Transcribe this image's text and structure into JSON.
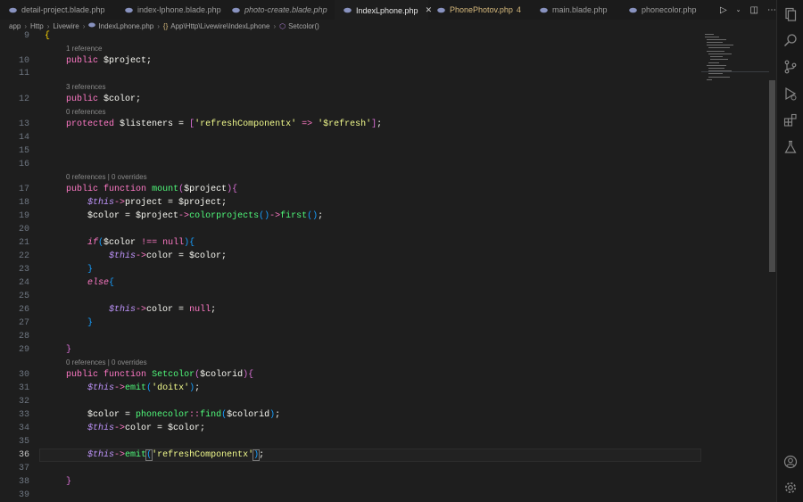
{
  "tabs": [
    {
      "label": "detail-project.blade.php",
      "active": false,
      "style": "normal"
    },
    {
      "label": "index-lphone.blade.php",
      "active": false,
      "style": "normal"
    },
    {
      "label": "photo-create.blade.php",
      "active": false,
      "style": "italic"
    },
    {
      "label": "IndexLphone.php",
      "active": true,
      "style": "normal"
    },
    {
      "label": "PhonePhotov.php",
      "badge": "4",
      "active": false,
      "style": "warn"
    },
    {
      "label": "main.blade.php",
      "active": false,
      "style": "normal"
    },
    {
      "label": "phonecolor.php",
      "active": false,
      "style": "normal"
    }
  ],
  "tab_close": "✕",
  "breadcrumb": [
    "app",
    "Http",
    "Livewire",
    "IndexLphone.php",
    "App\\Http\\Livewire\\IndexLphone",
    "Setcolor()"
  ],
  "code_lens": {
    "l10": "1 reference",
    "l12": "3 references",
    "l13": "0 references",
    "l17": "0 references | 0 overrides",
    "l30": "0 references | 0 overrides"
  },
  "line_numbers": [
    "9",
    "10",
    "11",
    "12",
    "13",
    "14",
    "15",
    "16",
    "17",
    "18",
    "19",
    "20",
    "21",
    "22",
    "23",
    "24",
    "25",
    "26",
    "27",
    "28",
    "29",
    "30",
    "31",
    "32",
    "33",
    "34",
    "35",
    "36",
    "37",
    "38",
    "39"
  ],
  "current_line": "36",
  "colors": {
    "background": "#1e1e1e",
    "keyword": "#ff79c6",
    "variable": "#bd93f9",
    "function": "#50fa7b",
    "string": "#f1fa8c",
    "warning_tab": "#d7ba7d"
  },
  "icons": [
    "php-file-icon",
    "explorer-icon",
    "search-icon",
    "source-control-icon",
    "run-debug-icon",
    "extensions-icon",
    "testing-icon",
    "account-icon",
    "settings-gear-icon",
    "run-icon",
    "split-editor-icon",
    "more-icon"
  ]
}
